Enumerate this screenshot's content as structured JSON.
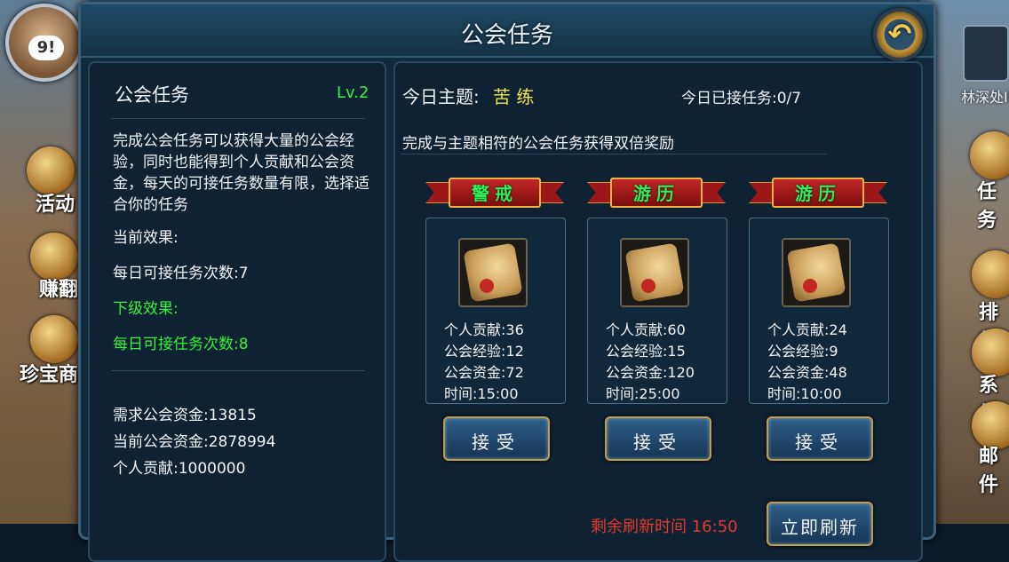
{
  "window": {
    "title": "公会任务"
  },
  "side_left": {
    "avatar_logo": "9!",
    "items": [
      {
        "label": "活动"
      },
      {
        "label": "赚翻"
      },
      {
        "label": "珍宝商"
      }
    ]
  },
  "side_right": {
    "top_label": "林深处II",
    "items": [
      {
        "label": "任务"
      },
      {
        "label": "排行"
      },
      {
        "label": "系统"
      },
      {
        "label": "邮件"
      }
    ]
  },
  "left_panel": {
    "heading": "公会任务",
    "level": "Lv.2",
    "description": "完成公会任务可以获得大量的公会经验，同时也能得到个人贡献和公会资金，每天的可接任务数量有限，选择适合你的任务",
    "current_effect_label": "当前效果:",
    "current_effect_value": "每日可接任务次数:7",
    "next_effect_label": "下级效果:",
    "next_effect_value": "每日可接任务次数:8",
    "required_funds": "需求公会资金:13815",
    "current_funds": "当前公会资金:2878994",
    "personal_contribution": "个人贡献:1000000"
  },
  "right_panel": {
    "theme_label": "今日主题:",
    "theme_value": "苦 练",
    "accepted_count": "今日已接任务:0/7",
    "subtitle": "完成与主题相符的公会任务获得双倍奖励",
    "tasks": [
      {
        "name": "警戒",
        "contribution": "个人贡献:36",
        "exp": "公会经验:12",
        "funds": "公会资金:72",
        "time": "时间:15:00",
        "button": "接受"
      },
      {
        "name": "游历",
        "contribution": "个人贡献:60",
        "exp": "公会经验:15",
        "funds": "公会资金:120",
        "time": "时间:25:00",
        "button": "接受"
      },
      {
        "name": "游历",
        "contribution": "个人贡献:24",
        "exp": "公会经验:9",
        "funds": "公会资金:48",
        "time": "时间:10:00",
        "button": "接受"
      }
    ],
    "refresh_timer": "剩余刷新时间 16:50",
    "refresh_button": "立即刷新"
  },
  "colors": {
    "accent_green": "#35f23b",
    "banner_red": "#c32626",
    "theme_yellow": "#f1e84a",
    "timer_red": "#e23b2b"
  }
}
